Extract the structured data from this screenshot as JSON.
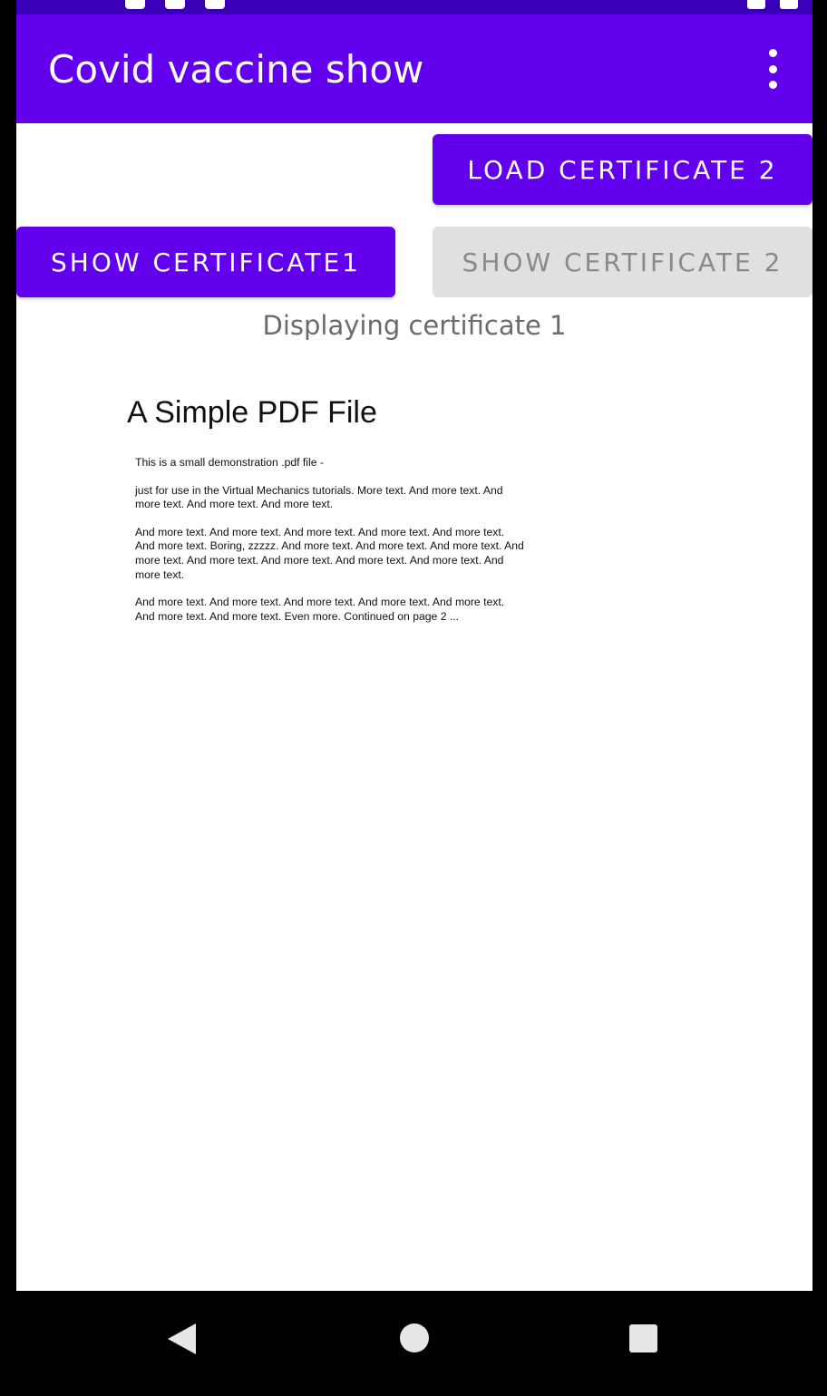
{
  "app_bar": {
    "title": "Covid vaccine show",
    "overflow_icon": "more-vert-icon",
    "color": "#6200ee"
  },
  "buttons": {
    "load_certificate_2": "LOAD CERTIFICATE 2",
    "show_certificate_1": "SHOW CERTIFICATE1",
    "show_certificate_2": "SHOW CERTIFICATE 2"
  },
  "status_text": "Displaying certificate 1",
  "pdf": {
    "title": "A Simple PDF File",
    "paragraphs": [
      "This is a small demonstration .pdf file -",
      "just for use in the Virtual Mechanics tutorials. More text. And more text. And more text. And more text. And more text.",
      "And more text. And more text. And more text. And more text. And more text. And more text. Boring, zzzzz. And more text. And more text. And more text. And more text. And more text. And more text. And more text. And more text. And more text.",
      "And more text. And more text. And more text. And more text. And more text. And more text. And more text. Even more. Continued on page 2 ..."
    ]
  },
  "nav_bar": {
    "back_icon": "back-icon",
    "home_icon": "home-icon",
    "recents_icon": "recents-icon"
  },
  "colors": {
    "primary": "#6200ee",
    "status_bar": "#3a00b8",
    "disabled_button": "#e0e0e0",
    "disabled_text": "#8a8a8a"
  }
}
